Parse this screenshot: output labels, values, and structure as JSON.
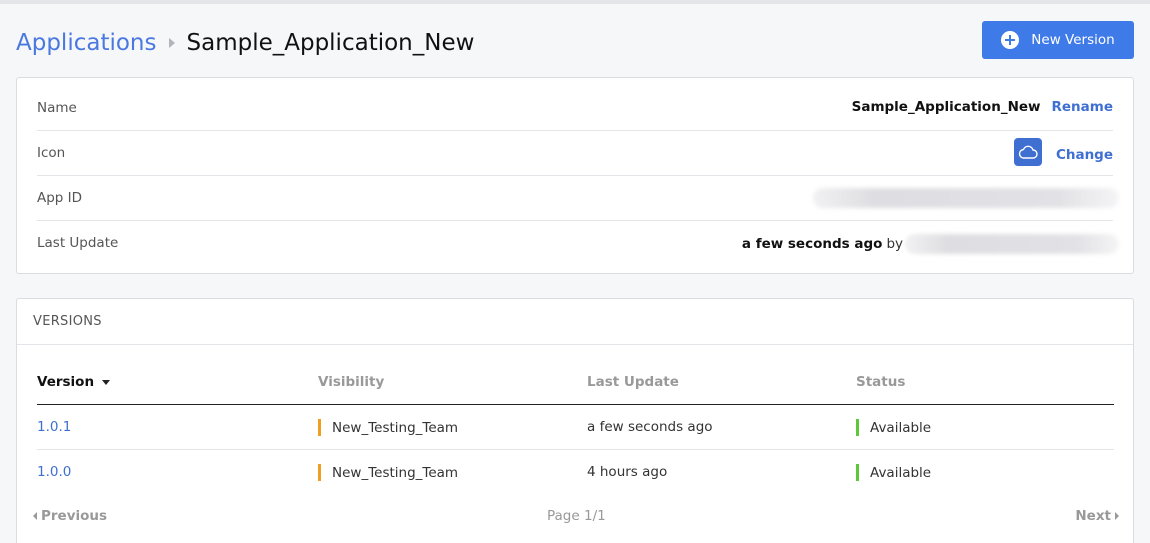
{
  "breadcrumb": {
    "root": "Applications",
    "current": "Sample_Application_New"
  },
  "actions": {
    "new_version": "New Version"
  },
  "info": {
    "name": {
      "label": "Name",
      "value": "Sample_Application_New",
      "action": "Rename"
    },
    "icon": {
      "label": "Icon",
      "icon_name": "cloud-icon",
      "action": "Change"
    },
    "app_id": {
      "label": "App ID"
    },
    "last_update": {
      "label": "Last Update",
      "value": "a few seconds ago",
      "by": "by"
    }
  },
  "versions": {
    "title": "VERSIONS",
    "columns": [
      "Version",
      "Visibility",
      "Last Update",
      "Status"
    ],
    "rows": [
      {
        "version": "1.0.1",
        "visibility": "New_Testing_Team",
        "last_update": "a few seconds ago",
        "status": "Available"
      },
      {
        "version": "1.0.0",
        "visibility": "New_Testing_Team",
        "last_update": "4 hours ago",
        "status": "Available"
      }
    ],
    "pager": {
      "previous": "Previous",
      "page": "Page 1/1",
      "next": "Next"
    }
  },
  "colors": {
    "accent": "#3f7ae9",
    "link": "#3f6fd0",
    "visibility_bar": "#f0a020",
    "status_available": "#5cc73a"
  }
}
